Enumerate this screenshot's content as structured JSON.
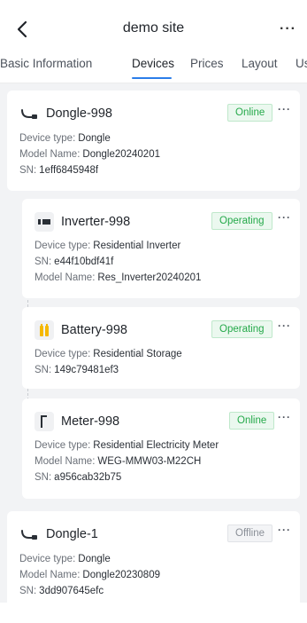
{
  "header": {
    "title": "demo site",
    "back_label": "<",
    "more_label": "···"
  },
  "tabs": [
    {
      "label": "Basic Information"
    },
    {
      "label": "Devices"
    },
    {
      "label": "Prices"
    },
    {
      "label": "Layout"
    },
    {
      "label": "Us"
    }
  ],
  "devices": [
    {
      "name": "Dongle-998",
      "status": "Online",
      "icon": "dongle-icon",
      "lines": [
        {
          "label": "Device type:",
          "value": "Dongle"
        },
        {
          "label": "Model Name:",
          "value": "Dongle20240201"
        },
        {
          "label": "SN:",
          "value": "1eff6845948f"
        }
      ]
    },
    {
      "name": "Inverter-998",
      "status": "Operating",
      "icon": "inverter-icon",
      "lines": [
        {
          "label": "Device type:",
          "value": "Residential Inverter"
        },
        {
          "label": "SN:",
          "value": "e44f10bdf41f"
        },
        {
          "label": "Model Name:",
          "value": "Res_Inverter20240201"
        }
      ]
    },
    {
      "name": "Battery-998",
      "status": "Operating",
      "icon": "battery-icon",
      "lines": [
        {
          "label": "Device type:",
          "value": "Residential Storage"
        },
        {
          "label": "SN:",
          "value": "149c79481ef3"
        }
      ]
    },
    {
      "name": "Meter-998",
      "status": "Online",
      "icon": "meter-icon",
      "lines": [
        {
          "label": "Device type:",
          "value": "Residential Electricity Meter"
        },
        {
          "label": "Model Name:",
          "value": "WEG-MMW03-M22CH"
        },
        {
          "label": "SN:",
          "value": "a956cab32b75"
        }
      ]
    },
    {
      "name": "Dongle-1",
      "status": "Offline",
      "icon": "dongle-icon",
      "lines": [
        {
          "label": "Device type:",
          "value": "Dongle"
        },
        {
          "label": "Model Name:",
          "value": "Dongle20230809"
        },
        {
          "label": "SN:",
          "value": "3dd907645efc"
        }
      ]
    }
  ],
  "more_label": "···",
  "colors": {
    "accent": "#2b7de9",
    "online": "#25a94a",
    "offline": "#8a8f97",
    "battery": "#f5b800"
  }
}
